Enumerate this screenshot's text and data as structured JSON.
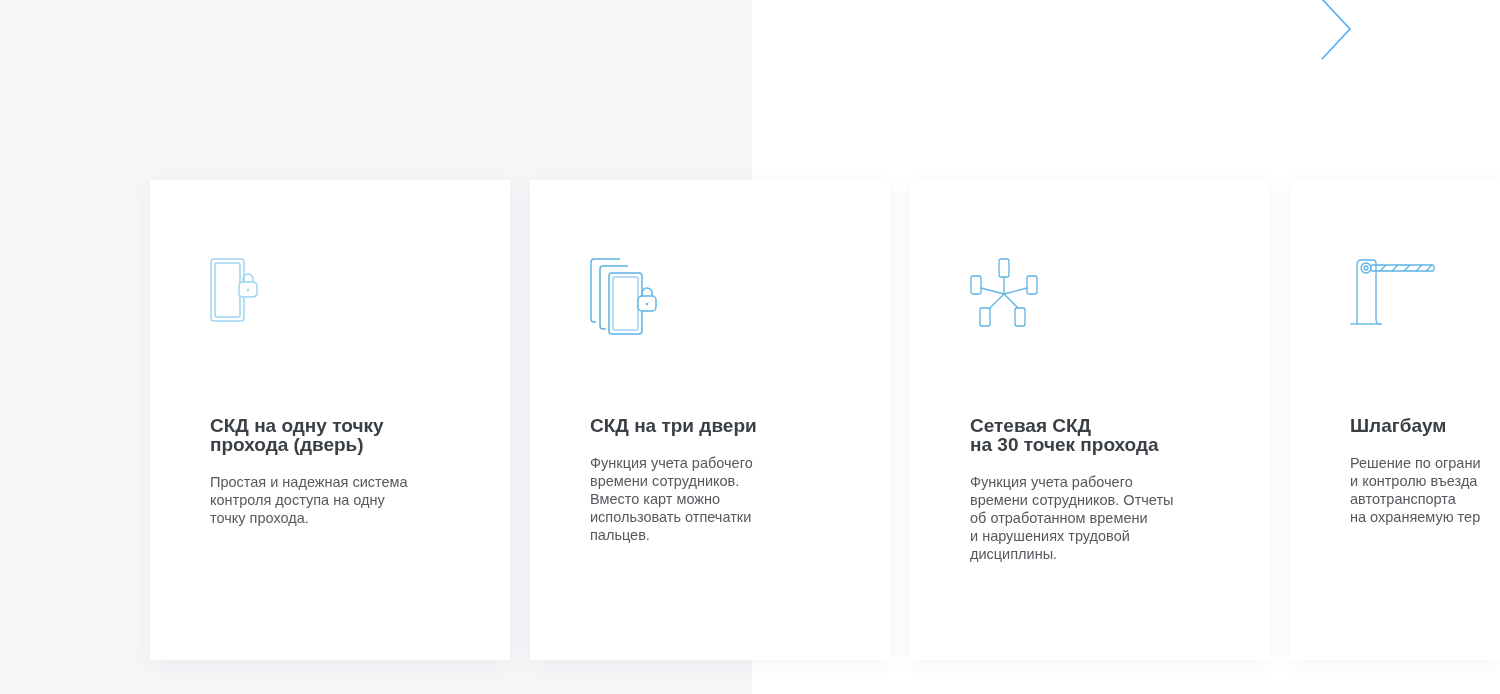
{
  "next_button": {
    "kind": "chevron"
  },
  "cards": [
    {
      "kind": "door",
      "title": "СКД на одну точку\nпрохода (дверь)",
      "description": "Простая и надежная система\nконтроля доступа на одну\nточку прохода."
    },
    {
      "kind": "doors",
      "title": "СКД на три двери",
      "description": "Функция учета рабочего\nвремени сотрудников.\nВместо карт можно\nиспользовать отпечатки\nпальцев."
    },
    {
      "kind": "network",
      "title": "Сетевая СКД\nна 30 точек прохода",
      "description": "Функция учета рабочего\nвремени сотрудников. Отчеты\nоб отработанном времени\nи нарушениях трудовой\nдисциплины."
    },
    {
      "kind": "barrier",
      "title": "Шлагбаум",
      "description": "Решение по ограни\nи контролю въезда\nавтотранспорта\nна охраняемую тер"
    }
  ]
}
